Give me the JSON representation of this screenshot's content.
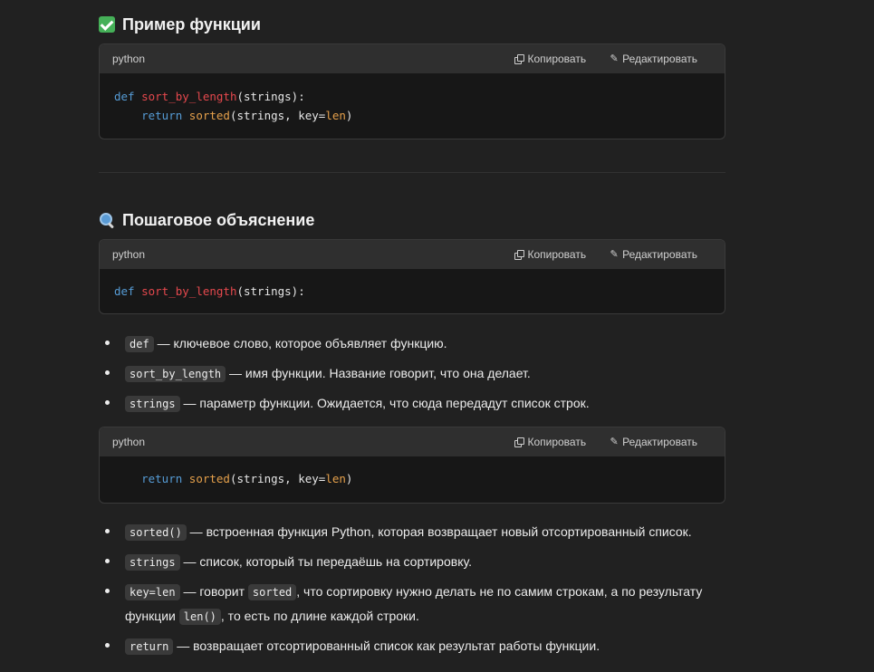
{
  "section1": {
    "title": "Пример функции",
    "codeblock": {
      "lang": "python",
      "copy_label": "Копировать",
      "edit_label": "Редактировать",
      "line1": {
        "kw": "def",
        "fn": "sort_by_length",
        "rest": "(strings):"
      },
      "line2": {
        "indent": "    ",
        "kw": "return",
        "bi": "sorted",
        "rest1": "(strings, key=",
        "bi2": "len",
        "rest2": ")"
      }
    }
  },
  "section2": {
    "title": "Пошаговое объяснение",
    "codeblock": {
      "lang": "python",
      "copy_label": "Копировать",
      "edit_label": "Редактировать",
      "line1": {
        "kw": "def",
        "fn": "sort_by_length",
        "rest": "(strings):"
      }
    },
    "bullets1": [
      {
        "code": "def",
        "text": " — ключевое слово, которое объявляет функцию."
      },
      {
        "code": "sort_by_length",
        "text": " — имя функции. Название говорит, что она делает."
      },
      {
        "code": "strings",
        "text": " — параметр функции. Ожидается, что сюда передадут список строк."
      }
    ],
    "codeblock2": {
      "lang": "python",
      "copy_label": "Копировать",
      "edit_label": "Редактировать",
      "line1": {
        "indent": "    ",
        "kw": "return",
        "bi": "sorted",
        "rest1": "(strings, key=",
        "bi2": "len",
        "rest2": ")"
      }
    },
    "bullets2": [
      {
        "code": "sorted()",
        "text": " — встроенная функция Python, которая возвращает новый отсортированный список."
      },
      {
        "code": "strings",
        "text": " — список, который ты передаёшь на сортировку."
      },
      {
        "code": "key=len",
        "text_a": " — говорит ",
        "code_b": "sorted",
        "text_b": ", что сортировку нужно делать не по самим строкам, а по результату функции ",
        "code_c": "len()",
        "text_c": ", то есть по длине каждой строки."
      },
      {
        "code": "return",
        "text": " — возвращает отсортированный список как результат работы функции."
      }
    ]
  },
  "colors": {
    "background": "#212121",
    "keyword": "#569cd6",
    "function_name": "#e5484d",
    "builtin": "#e5a04b"
  }
}
